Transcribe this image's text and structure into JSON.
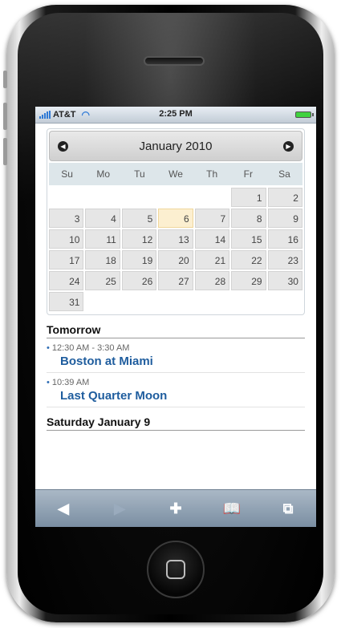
{
  "status": {
    "carrier": "AT&T",
    "time": "2:25 PM"
  },
  "calendar": {
    "month_label": "January 2010",
    "prev_icon": "chevron-left-icon",
    "next_icon": "chevron-right-icon",
    "weekdays": [
      "Su",
      "Mo",
      "Tu",
      "We",
      "Th",
      "Fr",
      "Sa"
    ],
    "rows": [
      [
        "",
        "",
        "",
        "",
        "",
        "1",
        "2"
      ],
      [
        "3",
        "4",
        "5",
        "6",
        "7",
        "8",
        "9"
      ],
      [
        "10",
        "11",
        "12",
        "13",
        "14",
        "15",
        "16"
      ],
      [
        "17",
        "18",
        "19",
        "20",
        "21",
        "22",
        "23"
      ],
      [
        "24",
        "25",
        "26",
        "27",
        "28",
        "29",
        "30"
      ],
      [
        "31",
        "",
        "",
        "",
        "",
        "",
        ""
      ]
    ],
    "today": "6"
  },
  "agenda": {
    "sections": [
      {
        "heading": "Tomorrow",
        "events": [
          {
            "time": "12:30 AM - 3:30 AM",
            "title": "Boston at Miami"
          },
          {
            "time": "10:39 AM",
            "title": "Last Quarter Moon"
          }
        ]
      },
      {
        "heading": "Saturday January 9",
        "events": []
      }
    ]
  },
  "toolbar": {
    "back_icon": "back-arrow-icon",
    "forward_icon": "forward-arrow-icon",
    "add_icon": "plus-icon",
    "bookmarks_icon": "bookmarks-icon",
    "pages_icon": "pages-icon"
  }
}
